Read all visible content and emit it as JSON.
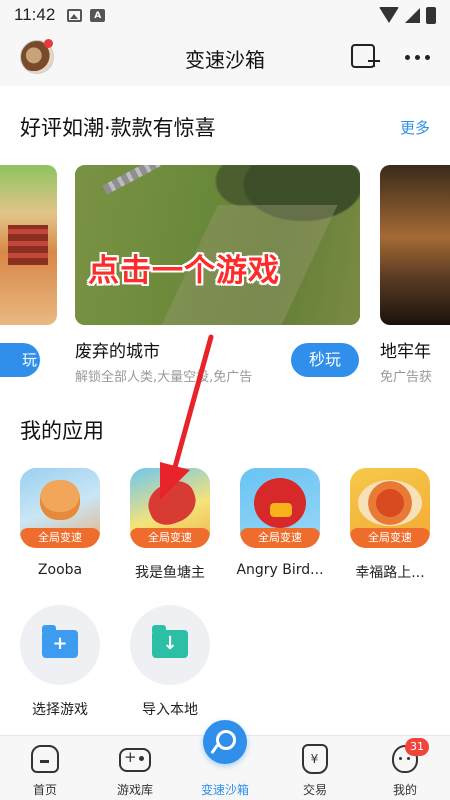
{
  "status_bar": {
    "time": "11:42",
    "icons": [
      "image-icon",
      "font-icon",
      "wifi-icon",
      "signal-icon",
      "battery-icon"
    ]
  },
  "header": {
    "title": "变速沙箱",
    "left_icon": "avatar",
    "right_icons": [
      "add-window-icon",
      "more-icon"
    ]
  },
  "featured": {
    "title": "好评如潮·款款有惊喜",
    "more": "更多",
    "cards": [
      {
        "button": "玩"
      },
      {
        "name": "废弃的城市",
        "desc": "解锁全部人类,大量空投,免广告",
        "button": "秒玩"
      },
      {
        "name": "地牢年",
        "desc": "免广告获"
      }
    ],
    "overlay_caption": "点击一个游戏"
  },
  "my_apps": {
    "title": "我的应用",
    "apps": [
      {
        "name": "Zooba",
        "tag": "全局变速"
      },
      {
        "name": "我是鱼塘主",
        "tag": "全局变速"
      },
      {
        "name": "Angry Bird...",
        "tag": "全局变速"
      },
      {
        "name": "幸福路上...",
        "tag": "全局变速"
      }
    ],
    "actions": [
      {
        "label": "选择游戏",
        "icon": "folder-add-icon"
      },
      {
        "label": "导入本地",
        "icon": "folder-download-icon"
      }
    ]
  },
  "bottom_nav": {
    "items": [
      {
        "label": "首页",
        "icon": "home-icon"
      },
      {
        "label": "游戏库",
        "icon": "gamepad-icon"
      },
      {
        "label": "变速沙箱",
        "icon": "key-icon",
        "active": true
      },
      {
        "label": "交易",
        "icon": "money-bag-icon"
      },
      {
        "label": "我的",
        "icon": "profile-icon"
      }
    ],
    "badge": "31"
  },
  "colors": {
    "accent": "#2f8fea",
    "tag": "#ef6d2c",
    "annotation": "#ff2a2a"
  }
}
